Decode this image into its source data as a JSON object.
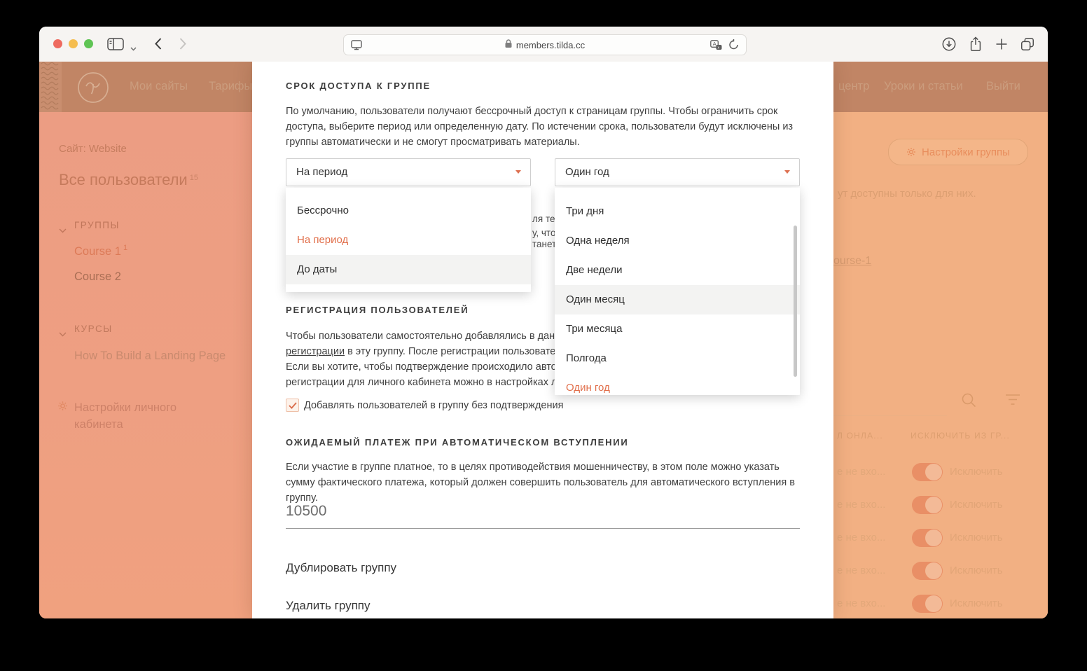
{
  "colors": {
    "accent": "#dd6f4d",
    "nav_bg": "#c18565",
    "sidebar_bg": "#ec9d83",
    "right_bg": "#f2b083",
    "toggle_track": "#e98f66",
    "titlebar_bg": "#f6f4f2"
  },
  "browser": {
    "url": "members.tilda.cc"
  },
  "navbar": {
    "items_left": [
      {
        "label": "Мои сайты"
      },
      {
        "label": "Тарифы"
      }
    ],
    "items_right": [
      {
        "label": "центр"
      },
      {
        "label": "Уроки и статьи"
      },
      {
        "label": "Выйти"
      }
    ]
  },
  "sidebar": {
    "site": "Сайт: Website",
    "all_users": "Все пользователи",
    "all_users_count": "15",
    "groups_title": "ГРУППЫ",
    "group_items": [
      {
        "label": "Course 1",
        "count": "1"
      },
      {
        "label": "Course 2"
      }
    ],
    "courses_title": "КУРСЫ",
    "course_items": [
      {
        "label": "How To Build a Landing Page"
      }
    ],
    "settings": "Настройки личного кабинета"
  },
  "right_pane": {
    "group_settings_button": "Настройки группы",
    "partial_text": "ут доступны только для них.",
    "partial_link": "ourse-1",
    "col_header_1": "Л ОНЛА...",
    "col_header_2": "ИСКЛЮЧИТЬ ИЗ ГР...",
    "rows": [
      {
        "cell": "е не вхо...",
        "toggle_label": "Исключить"
      },
      {
        "cell": "е не вхо...",
        "toggle_label": "Исключить"
      },
      {
        "cell": "е не вхо...",
        "toggle_label": "Исключить"
      },
      {
        "cell": "е не вхо...",
        "toggle_label": "Исключить"
      },
      {
        "cell": "е не вхо...",
        "toggle_label": "Исключить"
      }
    ]
  },
  "modal": {
    "access": {
      "title": "СРОК ДОСТУПА К ГРУППЕ",
      "description": "По умолчанию, пользователи получают бессрочный доступ к страницам группы. Чтобы ограничить срок доступа, выберите период или определенную дату. По истечении срока, пользователи будут исключены из группы автоматически и не смогут просматривать материалы.",
      "period_value": "На период",
      "period_options": [
        "Бессрочно",
        "На период",
        "До даты"
      ],
      "duration_value": "Один год",
      "duration_options": [
        "Три дня",
        "Одна неделя",
        "Две недели",
        "Один месяц",
        "Три месяца",
        "Полгода",
        "Один год"
      ],
      "background_fragments": [
        "ля тек",
        "у, что",
        "танет"
      ]
    },
    "registration": {
      "title": "РЕГИСТРАЦИЯ ПОЛЬЗОВАТЕЛЕЙ",
      "line1": "Чтобы пользователи самостоятельно добавлялись в данную",
      "line2_link": "регистрации",
      "line2_rest": " в эту группу. После регистрации пользователя",
      "line3": "Если вы хотите, чтобы подтверждение происходило автома",
      "line4": "регистрации для личного кабинета можно в настройках лич",
      "checkbox_label": "Добавлять пользователей в группу без подтверждения"
    },
    "payment": {
      "title": "ОЖИДАЕМЫЙ ПЛАТЕЖ ПРИ АВТОМАТИЧЕСКОМ ВСТУПЛЕНИИ",
      "description": "Если участие в группе платное, то в целях противодействия мошенничеству, в этом поле можно указать сумму фактического платежа, который должен совершить пользователь для автоматического вступления в группу.",
      "amount": "10500"
    },
    "actions": {
      "duplicate": "Дублировать группу",
      "delete": "Удалить группу"
    }
  }
}
